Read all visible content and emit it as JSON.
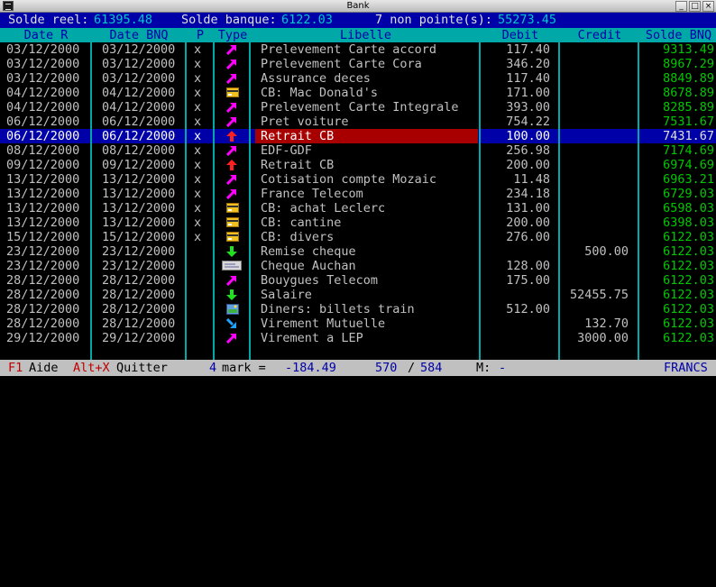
{
  "window": {
    "title": "Bank"
  },
  "summary": {
    "solde_reel_label": "Solde reel:",
    "solde_reel_value": "61395.48",
    "solde_banque_label": "Solde banque:",
    "solde_banque_value": "6122.03",
    "non_pointe_label": "7 non pointe(s):",
    "non_pointe_value": "55273.45"
  },
  "columns": {
    "date_r": "Date R",
    "date_bnq": "Date BNQ",
    "p": "P",
    "type": "Type",
    "libelle": "Libelle",
    "debit": "Debit",
    "credit": "Credit",
    "solde_bnq": "Solde BNQ"
  },
  "rows": [
    {
      "date_r": "03/12/2000",
      "date_bnq": "03/12/2000",
      "p": "x",
      "icon": "magenta-arrow-icon",
      "libelle": "Prelevement Carte accord",
      "debit": "117.40",
      "credit": "",
      "solde": "9313.49"
    },
    {
      "date_r": "03/12/2000",
      "date_bnq": "03/12/2000",
      "p": "x",
      "icon": "magenta-arrow-icon",
      "libelle": "Prelevement Carte Cora",
      "debit": "346.20",
      "credit": "",
      "solde": "8967.29"
    },
    {
      "date_r": "03/12/2000",
      "date_bnq": "03/12/2000",
      "p": "x",
      "icon": "magenta-arrow-icon",
      "libelle": "Assurance deces",
      "debit": "117.40",
      "credit": "",
      "solde": "8849.89"
    },
    {
      "date_r": "04/12/2000",
      "date_bnq": "04/12/2000",
      "p": "x",
      "icon": "credit-card-icon",
      "libelle": "CB: Mac Donald's",
      "debit": "171.00",
      "credit": "",
      "solde": "8678.89"
    },
    {
      "date_r": "04/12/2000",
      "date_bnq": "04/12/2000",
      "p": "x",
      "icon": "magenta-arrow-icon",
      "libelle": "Prelevement Carte Integrale",
      "debit": "393.00",
      "credit": "",
      "solde": "8285.89"
    },
    {
      "date_r": "06/12/2000",
      "date_bnq": "06/12/2000",
      "p": "x",
      "icon": "magenta-arrow-icon",
      "libelle": "Pret voiture",
      "debit": "754.22",
      "credit": "",
      "solde": "7531.67"
    },
    {
      "date_r": "06/12/2000",
      "date_bnq": "06/12/2000",
      "p": "x",
      "icon": "red-up-arrow-icon",
      "libelle": "Retrait CB",
      "debit": "100.00",
      "credit": "",
      "solde": "7431.67",
      "selected": true
    },
    {
      "date_r": "08/12/2000",
      "date_bnq": "08/12/2000",
      "p": "x",
      "icon": "magenta-arrow-icon",
      "libelle": "EDF-GDF",
      "debit": "256.98",
      "credit": "",
      "solde": "7174.69"
    },
    {
      "date_r": "09/12/2000",
      "date_bnq": "09/12/2000",
      "p": "x",
      "icon": "red-up-arrow-icon",
      "libelle": "Retrait CB",
      "debit": "200.00",
      "credit": "",
      "solde": "6974.69"
    },
    {
      "date_r": "13/12/2000",
      "date_bnq": "13/12/2000",
      "p": "x",
      "icon": "magenta-arrow-icon",
      "libelle": "Cotisation compte Mozaic",
      "debit": "11.48",
      "credit": "",
      "solde": "6963.21"
    },
    {
      "date_r": "13/12/2000",
      "date_bnq": "13/12/2000",
      "p": "x",
      "icon": "magenta-arrow-icon",
      "libelle": "France Telecom",
      "debit": "234.18",
      "credit": "",
      "solde": "6729.03"
    },
    {
      "date_r": "13/12/2000",
      "date_bnq": "13/12/2000",
      "p": "x",
      "icon": "credit-card-icon",
      "libelle": "CB: achat Leclerc",
      "debit": "131.00",
      "credit": "",
      "solde": "6598.03"
    },
    {
      "date_r": "13/12/2000",
      "date_bnq": "13/12/2000",
      "p": "x",
      "icon": "credit-card-icon",
      "libelle": "CB: cantine",
      "debit": "200.00",
      "credit": "",
      "solde": "6398.03"
    },
    {
      "date_r": "15/12/2000",
      "date_bnq": "15/12/2000",
      "p": "x",
      "icon": "credit-card-icon",
      "libelle": "CB: divers",
      "debit": "276.00",
      "credit": "",
      "solde": "6122.03"
    },
    {
      "date_r": "23/12/2000",
      "date_bnq": "23/12/2000",
      "p": "",
      "icon": "green-down-arrow-icon",
      "libelle": "Remise cheque",
      "debit": "",
      "credit": "500.00",
      "solde": "6122.03"
    },
    {
      "date_r": "23/12/2000",
      "date_bnq": "23/12/2000",
      "p": "",
      "icon": "cheque-icon",
      "libelle": "Cheque Auchan",
      "debit": "128.00",
      "credit": "",
      "solde": "6122.03"
    },
    {
      "date_r": "28/12/2000",
      "date_bnq": "28/12/2000",
      "p": "",
      "icon": "magenta-arrow-icon",
      "libelle": "Bouygues Telecom",
      "debit": "175.00",
      "credit": "",
      "solde": "6122.03"
    },
    {
      "date_r": "28/12/2000",
      "date_bnq": "28/12/2000",
      "p": "",
      "icon": "green-down-arrow-icon",
      "libelle": "Salaire",
      "debit": "",
      "credit": "52455.75",
      "solde": "6122.03"
    },
    {
      "date_r": "28/12/2000",
      "date_bnq": "28/12/2000",
      "p": "",
      "icon": "ticket-icon",
      "libelle": "Diners: billets train",
      "debit": "512.00",
      "credit": "",
      "solde": "6122.03"
    },
    {
      "date_r": "28/12/2000",
      "date_bnq": "28/12/2000",
      "p": "",
      "icon": "blue-down-arrow-icon",
      "libelle": "Virement Mutuelle",
      "debit": "",
      "credit": "132.70",
      "solde": "6122.03"
    },
    {
      "date_r": "29/12/2000",
      "date_bnq": "29/12/2000",
      "p": "",
      "icon": "magenta-arrow-icon",
      "libelle": "Virement a LEP",
      "debit": "",
      "credit": "3000.00",
      "solde": "6122.03"
    }
  ],
  "status": {
    "f1_key": "F1",
    "f1_label": "Aide",
    "altx_key": "Alt+X",
    "altx_label": "Quitter",
    "mark_count": "4",
    "mark_label": "mark =",
    "mark_value": "-184.49",
    "position_current": "570",
    "position_sep": "/",
    "position_total": "584",
    "m_label": "M:",
    "m_value": "-",
    "currency": "FRANCS"
  },
  "colors": {
    "background": "#000000",
    "info_bar": "#0000a8",
    "column_header": "#00a8a8",
    "selection_row": "#0000a8",
    "selection_label": "#a80000",
    "balance_text": "#00c800"
  }
}
